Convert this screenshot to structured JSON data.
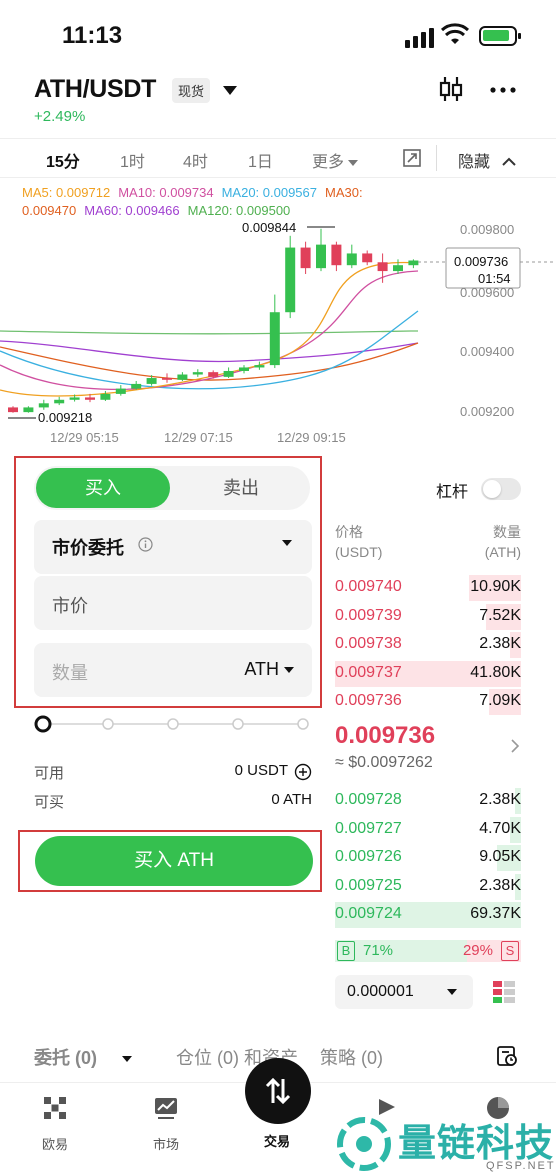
{
  "status_bar": {
    "time": "11:13"
  },
  "header": {
    "pair": "ATH/USDT",
    "market_badge": "现货",
    "change": "+2.49%",
    "icons": [
      "candlestick-settings-icon",
      "more-icon"
    ]
  },
  "timeframes": {
    "items": [
      "15分",
      "1时",
      "4时",
      "1日",
      "更多"
    ],
    "active": "15分",
    "hide_label": "隐藏"
  },
  "ma_legend": {
    "line1": [
      {
        "label": "MA5: 0.009712",
        "color": "#f0a020"
      },
      {
        "label": "MA10: 0.009734",
        "color": "#d050a0"
      },
      {
        "label": "MA20: 0.009567",
        "color": "#3ab0e0"
      },
      {
        "label": "MA30:",
        "color": "#e06020"
      }
    ],
    "line2": [
      {
        "label": "0.009470",
        "color": "#e06020"
      },
      {
        "label": "MA60: 0.009466",
        "color": "#a040d0"
      },
      {
        "label": "MA120: 0.009500",
        "color": "#50b050"
      }
    ]
  },
  "chart_data": {
    "type": "candlestick",
    "high_label": "0.009844",
    "low_label": "0.009218",
    "current_price_label": "0.009736",
    "countdown": "01:54",
    "y_ticks": [
      "0.009800",
      "0.009600",
      "0.009400",
      "0.009200"
    ],
    "ylim": [
      0.0092,
      0.00985
    ],
    "x_ticks": [
      "12/29 05:15",
      "12/29 07:15",
      "12/29 09:15"
    ],
    "candles": [
      {
        "o": 0.009236,
        "c": 0.00922,
        "h": 0.00924,
        "l": 0.009218
      },
      {
        "o": 0.00922,
        "c": 0.009236,
        "h": 0.00924,
        "l": 0.009218
      },
      {
        "o": 0.009236,
        "c": 0.00925,
        "h": 0.009262,
        "l": 0.009228
      },
      {
        "o": 0.00925,
        "c": 0.009262,
        "h": 0.009272,
        "l": 0.009244
      },
      {
        "o": 0.009262,
        "c": 0.00927,
        "h": 0.00928,
        "l": 0.009256
      },
      {
        "o": 0.00927,
        "c": 0.009262,
        "h": 0.009282,
        "l": 0.009254
      },
      {
        "o": 0.009262,
        "c": 0.009282,
        "h": 0.009292,
        "l": 0.009258
      },
      {
        "o": 0.009282,
        "c": 0.0093,
        "h": 0.009312,
        "l": 0.009276
      },
      {
        "o": 0.0093,
        "c": 0.009316,
        "h": 0.009326,
        "l": 0.009296
      },
      {
        "o": 0.009316,
        "c": 0.009336,
        "h": 0.009346,
        "l": 0.00931
      },
      {
        "o": 0.009336,
        "c": 0.00933,
        "h": 0.009352,
        "l": 0.00932
      },
      {
        "o": 0.00933,
        "c": 0.009348,
        "h": 0.009356,
        "l": 0.009326
      },
      {
        "o": 0.009348,
        "c": 0.009356,
        "h": 0.009366,
        "l": 0.00934
      },
      {
        "o": 0.009356,
        "c": 0.00934,
        "h": 0.009362,
        "l": 0.009334
      },
      {
        "o": 0.00934,
        "c": 0.00936,
        "h": 0.009372,
        "l": 0.009336
      },
      {
        "o": 0.00936,
        "c": 0.009372,
        "h": 0.00938,
        "l": 0.009352
      },
      {
        "o": 0.009372,
        "c": 0.00938,
        "h": 0.009392,
        "l": 0.009364
      },
      {
        "o": 0.00938,
        "c": 0.00956,
        "h": 0.00962,
        "l": 0.00937
      },
      {
        "o": 0.00956,
        "c": 0.00978,
        "h": 0.00982,
        "l": 0.00954
      },
      {
        "o": 0.00978,
        "c": 0.00971,
        "h": 0.0098,
        "l": 0.00969
      },
      {
        "o": 0.00971,
        "c": 0.00979,
        "h": 0.009844,
        "l": 0.0097
      },
      {
        "o": 0.00979,
        "c": 0.00972,
        "h": 0.0098,
        "l": 0.0097
      },
      {
        "o": 0.00972,
        "c": 0.00976,
        "h": 0.00979,
        "l": 0.00971
      },
      {
        "o": 0.00976,
        "c": 0.00973,
        "h": 0.00977,
        "l": 0.00972
      },
      {
        "o": 0.00973,
        "c": 0.0097,
        "h": 0.00976,
        "l": 0.00966
      },
      {
        "o": 0.0097,
        "c": 0.00972,
        "h": 0.00974,
        "l": 0.00969
      },
      {
        "o": 0.00972,
        "c": 0.009736,
        "h": 0.00974,
        "l": 0.00971
      }
    ],
    "up_color": "#35c04f",
    "down_color": "#e0405a",
    "grid": false
  },
  "order_form": {
    "buy_tab": "买入",
    "sell_tab": "卖出",
    "order_type": "市价委托",
    "price_field": "市价",
    "amount_placeholder": "数量",
    "amount_unit": "ATH",
    "available_label": "可用",
    "available_value": "0 USDT",
    "buyable_label": "可买",
    "buyable_value": "0 ATH",
    "submit_label": "买入 ATH",
    "accent": "#35c04f"
  },
  "leverage_label": "杠杆",
  "orderbook": {
    "price_header": "价格",
    "price_unit": "(USDT)",
    "qty_header": "数量",
    "qty_unit": "(ATH)",
    "asks": [
      {
        "price": "0.009740",
        "qty": "10.90K",
        "depth": 0.28
      },
      {
        "price": "0.009739",
        "qty": "7.52K",
        "depth": 0.19
      },
      {
        "price": "0.009738",
        "qty": "2.38K",
        "depth": 0.06
      },
      {
        "price": "0.009737",
        "qty": "41.80K",
        "depth": 1.0
      },
      {
        "price": "0.009736",
        "qty": "7.09K",
        "depth": 0.17
      }
    ],
    "last_price": "0.009736",
    "usd_price": "≈ $0.0097262",
    "bids": [
      {
        "price": "0.009728",
        "qty": "2.38K",
        "depth": 0.03
      },
      {
        "price": "0.009727",
        "qty": "4.70K",
        "depth": 0.06
      },
      {
        "price": "0.009726",
        "qty": "9.05K",
        "depth": 0.13
      },
      {
        "price": "0.009725",
        "qty": "2.38K",
        "depth": 0.03
      },
      {
        "price": "0.009724",
        "qty": "69.37K",
        "depth": 1.0
      }
    ],
    "buy_ratio_badge": "B",
    "buy_ratio": "71%",
    "sell_ratio": "29%",
    "sell_ratio_badge": "S",
    "buy_ratio_value": 0.71,
    "precision": "0.000001"
  },
  "order_tabs": {
    "items": [
      "委托 (0)",
      "仓位 (0) 和资产",
      "策略 (0)"
    ]
  },
  "bottom_nav": {
    "items": [
      "欧易",
      "市场",
      "交易"
    ]
  },
  "watermark": {
    "text": "量链科技",
    "sub": "QFSP.NET"
  }
}
